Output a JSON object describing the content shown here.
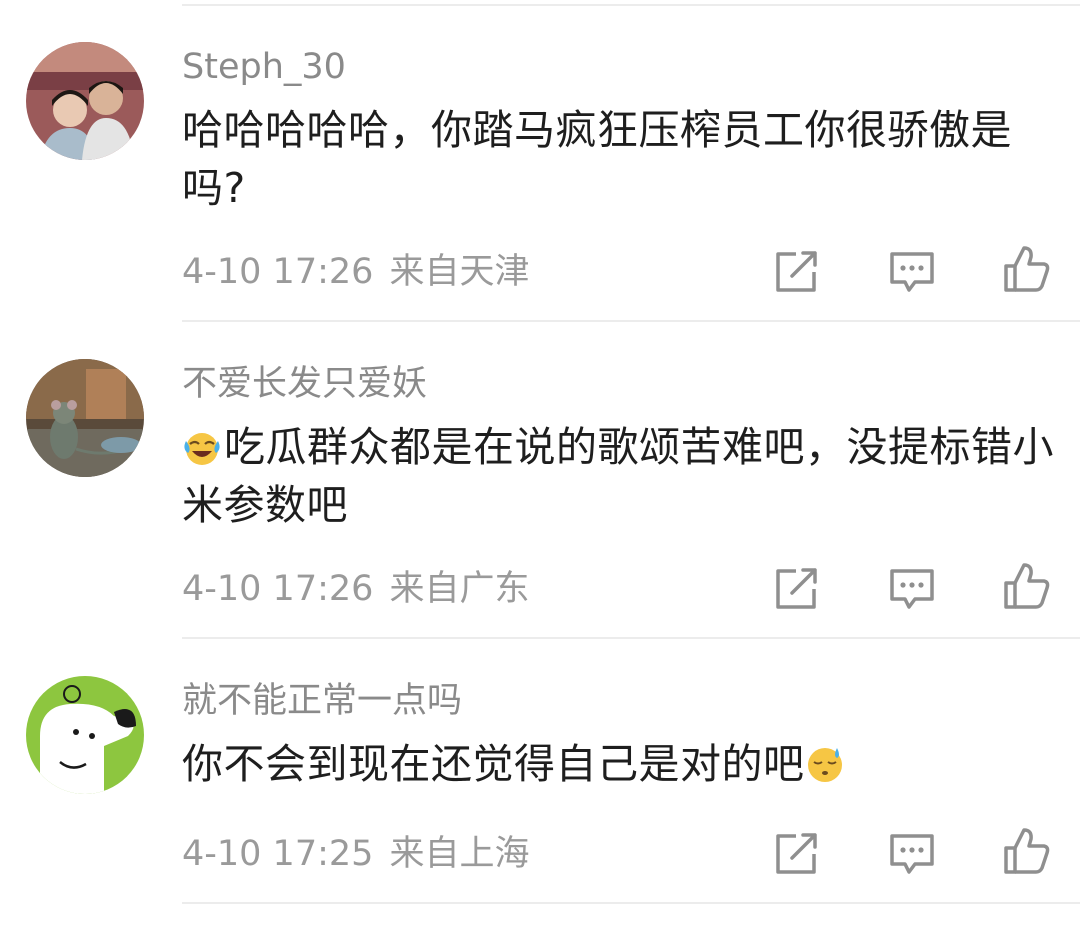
{
  "comments": [
    {
      "username": "Steph_30",
      "text": "哈哈哈哈哈，你踏马疯狂压榨员工你很骄傲是吗?",
      "time": "4-10 17:26",
      "location": "来自天津",
      "avatar_icon": "couple-photo-avatar"
    },
    {
      "username": "不爱长发只爱妖",
      "emoji": "laughing-crying-emoji",
      "text": "吃瓜群众都是在说的歌颂苦难吧，没提标错小米参数吧",
      "time": "4-10 17:26",
      "location": "来自广东",
      "avatar_icon": "rat-movie-still-avatar"
    },
    {
      "username": "就不能正常一点吗",
      "text": "你不会到现在还觉得自己是对的吧",
      "emoji": "sweat-face-emoji",
      "time": "4-10 17:25",
      "location": "来自上海",
      "avatar_icon": "dog-cartoon-avatar"
    }
  ],
  "actions": {
    "share_icon": "share-icon",
    "reply_icon": "comment-icon",
    "like_icon": "thumbs-up-icon"
  },
  "colors": {
    "username": "#8a8a8a",
    "text": "#1e1e1e",
    "meta": "#9a9a9a",
    "icon": "#8f8f8f"
  }
}
